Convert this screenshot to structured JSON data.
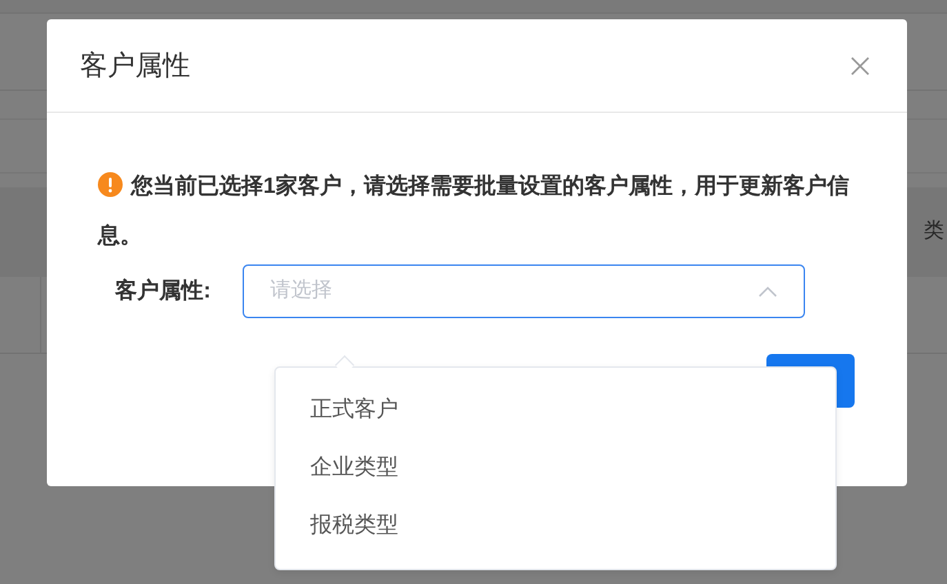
{
  "background": {
    "table_headers": [
      "类"
    ]
  },
  "dialog": {
    "title": "客户属性",
    "notice": "您当前已选择1家客户，请选择需要批量设置的客户属性，用于更新客户信息。",
    "field": {
      "label": "客户属性:",
      "placeholder": "请选择",
      "expanded": true
    },
    "options": [
      {
        "label": "正式客户",
        "selected": false
      },
      {
        "label": "企业类型",
        "selected": false
      },
      {
        "label": "报税类型",
        "selected": false
      }
    ]
  }
}
